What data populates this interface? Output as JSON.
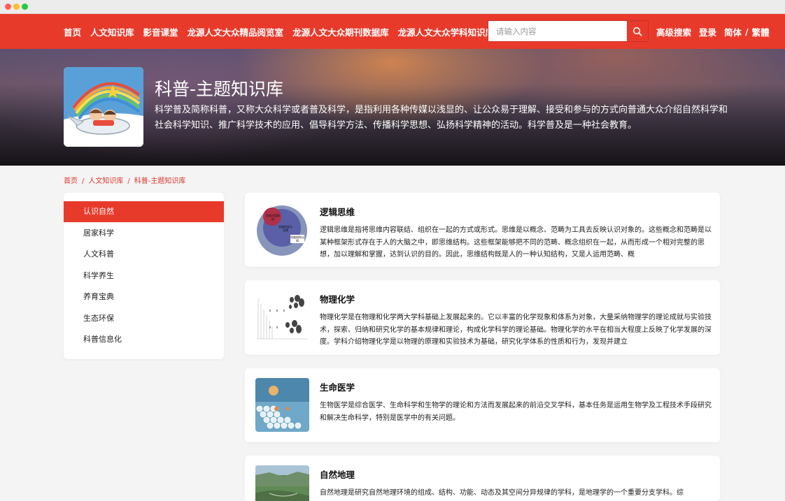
{
  "nav": {
    "links": [
      "首页",
      "人文知识库",
      "影音课堂",
      "龙源人文大众精品阅览室",
      "龙源人文大众期刊数据库",
      "龙源人文大众学科知识库"
    ],
    "search_placeholder": "请输入内容",
    "search_icon": "search-icon",
    "advanced_search": "高级搜索",
    "login": "登录",
    "lang_simplified": "简体",
    "lang_separator": "/",
    "lang_traditional": "繁體"
  },
  "banner": {
    "title": "科普-主题知识库",
    "description": "科学普及简称科普，又称大众科学或者普及科学，是指利用各种传媒以浅显的、让公众易于理解、接受和参与的方式向普通大众介绍自然科学和社会科学知识、推广科学技术的应用、倡导科学方法、传播科学思想、弘扬科学精神的活动。科学普及是一种社会教育。"
  },
  "breadcrumb": {
    "items": [
      "首页",
      "人文知识库",
      "科普-主题知识库"
    ],
    "separator": "/"
  },
  "sidebar": {
    "items": [
      "认识自然",
      "居家科学",
      "人文科普",
      "科学养生",
      "养育宝典",
      "生态环保",
      "科普信息化"
    ],
    "active_index": 0
  },
  "cards": [
    {
      "title": "逻辑思维",
      "text": "逻辑思维是指将思维内容联结、组织在一起的方式或形式。思维是以概念、范畴为工具去反映认识对象的。这些概念和范畴是以某种框架形式存在于人的大脑之中，即思维结构。这些框架能够把不同的范畴、概念组织在一起，从而形成一个相对完整的思想，加以理解和掌握，达到认识的目的。因此，思维结构既是人的一种认知结构，又是人运用范畴、概",
      "diagram_labels": [
        "思维内容联结",
        "思维框架与范畴",
        "思维结构认知"
      ]
    },
    {
      "title": "物理化学",
      "text": "物理化学是在物理和化学两大学科基础上发展起来的。它以丰富的化学现象和体系为对象，大量采纳物理学的理论成就与实验技术，探索、归纳和研究化学的基本规律和理论，构成化学科学的理论基础。物理化学的水平在相当大程度上反映了化学发展的深度。学科介绍物理化学是以物理的原理和实验技术为基础，研究化学体系的性质和行为，发现并建立"
    },
    {
      "title": "生命医学",
      "text": "生物医学是综合医学、生命科学和生物学的理论和方法而发展起来的前沿交叉学科，基本任务是运用生物学及工程技术手段研究和解决生命科学，特别是医学中的有关问题。"
    },
    {
      "title": "自然地理",
      "text": "自然地理是研究自然地理环境的组成、结构、功能、动态及其空间分异规律的学科，是地理学的一个重要分支学科。综"
    }
  ],
  "colors": {
    "brand_red": "#e83a2b",
    "page_bg": "#f4f4f5"
  }
}
